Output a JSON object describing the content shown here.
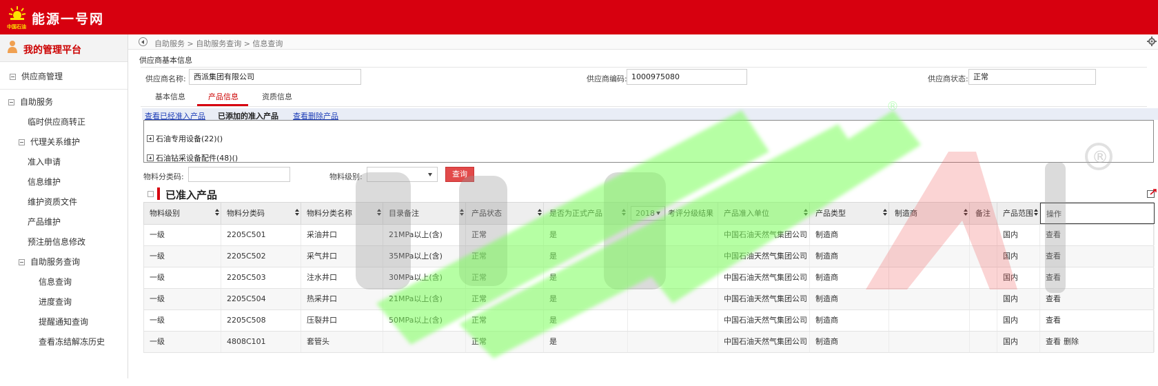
{
  "header": {
    "logo_text": "中国石油",
    "site_title": "能源一号网"
  },
  "sidebar": {
    "platform_title": "我的管理平台",
    "items": [
      {
        "label": "供应商管理"
      },
      {
        "label": "自助服务"
      },
      {
        "label": "临时供应商转正"
      },
      {
        "label": "代理关系维护"
      },
      {
        "label": "准入申请"
      },
      {
        "label": "信息维护"
      },
      {
        "label": "维护资质文件"
      },
      {
        "label": "产品维护"
      },
      {
        "label": "预注册信息修改"
      },
      {
        "label": "自助服务查询"
      },
      {
        "label": "信息查询"
      },
      {
        "label": "进度查询"
      },
      {
        "label": "提醒通知查询"
      },
      {
        "label": "查看冻结解冻历史"
      }
    ]
  },
  "breadcrumb": "自助服务 > 自助服务查询 > 信息查询",
  "section_title": "供应商基本信息",
  "supplier": {
    "name_label": "供应商名称:",
    "name_value": "西派集团有限公司",
    "code_label": "供应商编码:",
    "code_value": "1000975080",
    "status_label": "供应商状态:",
    "status_value": "正常"
  },
  "tabs": [
    {
      "label": "基本信息"
    },
    {
      "label": "产品信息"
    },
    {
      "label": "资质信息"
    }
  ],
  "subtabs": [
    {
      "label": "查看已经准入产品"
    },
    {
      "label": "已添加的准入产品"
    },
    {
      "label": "查看删除产品"
    }
  ],
  "tree": [
    {
      "label": "石油专用设备(22)()"
    },
    {
      "label": "石油钻采设备配件(48)()"
    }
  ],
  "filters": {
    "code_label": "物料分类码:",
    "level_label": "物料级别:",
    "query_label": "查询"
  },
  "list_title": "已准入产品",
  "table": {
    "year_value": "2018",
    "headers": [
      "物料级别",
      "物料分类码",
      "物料分类名称",
      "目录备注",
      "产品状态",
      "是否为正式产品",
      "考评分级结果",
      "产品准入单位",
      "产品类型",
      "制造商",
      "备注",
      "产品范围",
      "操作"
    ],
    "rows": [
      [
        "一级",
        "2205C501",
        "采油井口",
        "21MPa以上(含)",
        "正常",
        "是",
        "",
        "中国石油天然气集团公司",
        "制造商",
        "",
        "",
        "国内",
        "查看",
        ""
      ],
      [
        "一级",
        "2205C502",
        "采气井口",
        "35MPa以上(含)",
        "正常",
        "是",
        "",
        "中国石油天然气集团公司",
        "制造商",
        "",
        "",
        "国内",
        "查看",
        ""
      ],
      [
        "一级",
        "2205C503",
        "注水井口",
        "30MPa以上(含)",
        "正常",
        "是",
        "",
        "中国石油天然气集团公司",
        "制造商",
        "",
        "",
        "国内",
        "查看",
        ""
      ],
      [
        "一级",
        "2205C504",
        "热采井口",
        "21MPa以上(含)",
        "正常",
        "是",
        "",
        "中国石油天然气集团公司",
        "制造商",
        "",
        "",
        "国内",
        "查看",
        ""
      ],
      [
        "一级",
        "2205C508",
        "压裂井口",
        "50MPa以上(含)",
        "正常",
        "是",
        "",
        "中国石油天然气集团公司",
        "制造商",
        "",
        "",
        "国内",
        "查看",
        ""
      ],
      [
        "一级",
        "4808C101",
        "套管头",
        "",
        "正常",
        "是",
        "",
        "中国石油天然气集团公司",
        "制造商",
        "",
        "",
        "国内",
        "查看",
        "删除"
      ]
    ]
  },
  "watermark": {
    "text": "CEPAI",
    "registered": "®"
  },
  "colors": {
    "brand_red": "#d7000f",
    "watermark_green": "#7cff5a"
  }
}
